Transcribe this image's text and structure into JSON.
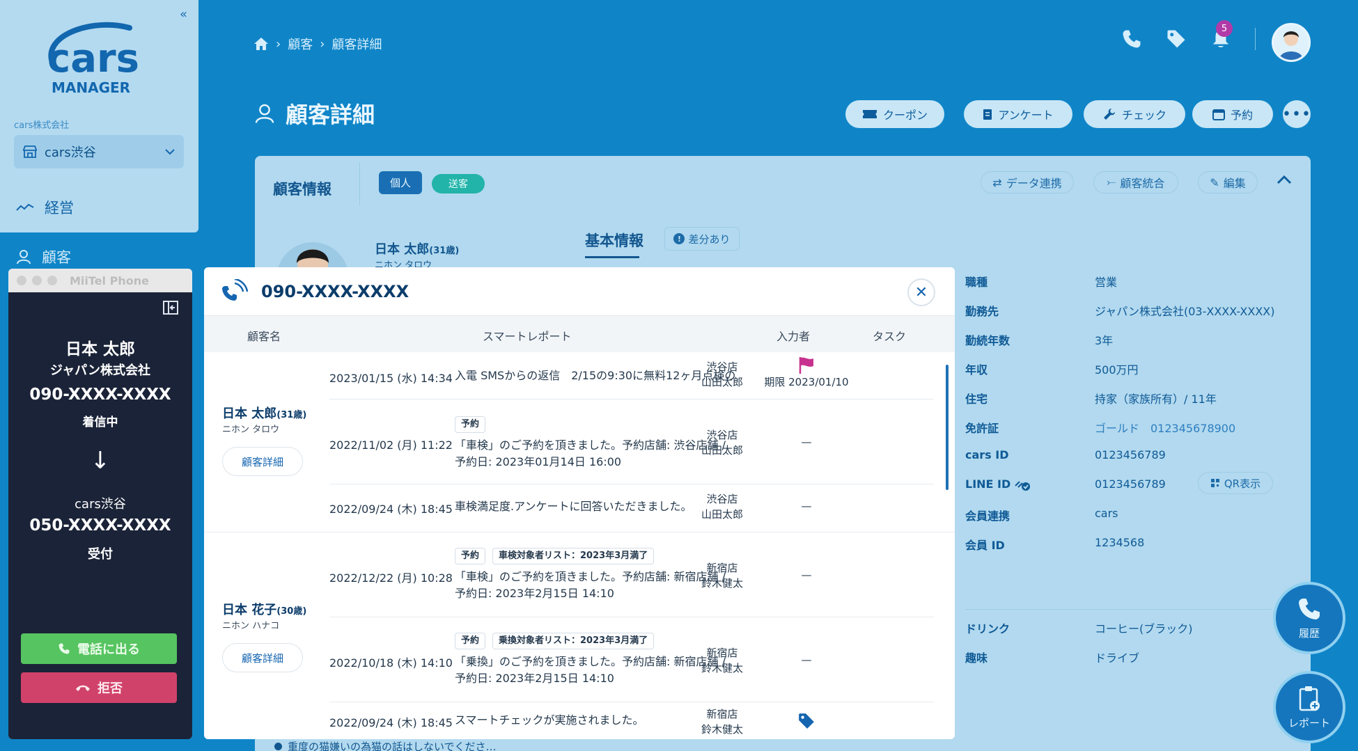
{
  "sidebar": {
    "logo_text": "cars",
    "logo_sub": "MANAGER",
    "company": "cars株式会社",
    "store": "cars渋谷",
    "nav": [
      {
        "label": "経営"
      },
      {
        "label": "顧客"
      }
    ]
  },
  "breadcrumb": {
    "items": [
      "顧客",
      "顧客詳細"
    ]
  },
  "header": {
    "notification_count": "5"
  },
  "page": {
    "title": "顧客詳細",
    "actions": [
      "クーポン",
      "アンケート",
      "チェック",
      "予約"
    ]
  },
  "card": {
    "title": "顧客情報",
    "tags": [
      "個人",
      "送客"
    ],
    "buttons": [
      "データ連携",
      "顧客統合",
      "編集"
    ],
    "customer_name": "日本 太郎",
    "customer_age": "(31歳)",
    "customer_kana": "ニホン タロウ",
    "tab": "基本情報",
    "diff_label": "差分あり",
    "info": [
      {
        "k": "職種",
        "v": "営業"
      },
      {
        "k": "勤務先",
        "v": "ジャパン株式会社(03-XXXX-XXXX)"
      },
      {
        "k": "勤続年数",
        "v": "3年"
      },
      {
        "k": "年収",
        "v": "500万円"
      },
      {
        "k": "住宅",
        "v": "持家（家族所有）/ 11年"
      },
      {
        "k": "免許証",
        "v": "ゴールド　012345678900"
      },
      {
        "k": "cars ID",
        "v": "0123456789"
      },
      {
        "k": "LINE ID",
        "v": "0123456789"
      },
      {
        "k": "会員連携",
        "v": "cars"
      },
      {
        "k": "会員 ID",
        "v": "1234568"
      }
    ],
    "qr_label": "QR表示",
    "info2": [
      {
        "k": "ドリンク",
        "v": "コーヒー(ブラック)"
      },
      {
        "k": "趣味",
        "v": "ドライブ"
      }
    ],
    "bottom_note": "重度の猫嫌いの為猫の話はしないでくださ…"
  },
  "fabs": {
    "history": "履歴",
    "report": "レポート"
  },
  "miitel": {
    "title": "MiiTel Phone",
    "caller_name": "日本 太郎",
    "caller_company": "ジャパン株式会社",
    "caller_number": "090-XXXX-XXXX",
    "status": "着信中",
    "arrow": "↓",
    "store": "cars渋谷",
    "store_number": "050-XXXX-XXXX",
    "store_status": "受付",
    "answer": "電話に出る",
    "reject": "拒否"
  },
  "modal": {
    "phone": "090-XXXX-XXXX",
    "headers": {
      "name": "顧客名",
      "report": "スマートレポート",
      "user": "入力者",
      "task": "タスク"
    },
    "groups": [
      {
        "name": "日本 太郎",
        "age": "(31歳)",
        "kana": "ニホン タロウ",
        "button": "顧客詳細",
        "rows": [
          {
            "date": "2023/01/15 (水) 14:34",
            "chips": [],
            "text": [
              "入電 SMSからの返信　2/15の9:30に無料12ヶ月点検の"
            ],
            "store": "渋谷店",
            "user": "山田太郎",
            "task": "期限 2023/01/10"
          },
          {
            "date": "2022/11/02 (月) 11:22",
            "chips": [
              "予約"
            ],
            "text": [
              "「車検」のご予約を頂きました。予約店舗: 渋谷店舗 /",
              "予約日: 2023年01月14日 16:00"
            ],
            "store": "渋谷店",
            "user": "山田太郎",
            "task": "—"
          },
          {
            "date": "2022/09/24 (木) 18:45",
            "chips": [],
            "text": [
              "車検満足度.アンケートに回答いただきました。"
            ],
            "store": "渋谷店",
            "user": "山田太郎",
            "task": "—"
          }
        ]
      },
      {
        "name": "日本 花子",
        "age": "(30歳)",
        "kana": "ニホン ハナコ",
        "button": "顧客詳細",
        "rows": [
          {
            "date": "2022/12/22 (月) 10:28",
            "chips": [
              "予約",
              "車検対象者リスト：2023年3月満了"
            ],
            "text": [
              "「車検」のご予約を頂きました。予約店舗: 新宿店舗 /",
              "予約日: 2023年2月15日 14:10"
            ],
            "store": "新宿店",
            "user": "鈴木健太",
            "task": "—"
          },
          {
            "date": "2022/10/18 (木) 14:10",
            "chips": [
              "予約",
              "乗換対象者リスト：2023年3月満了"
            ],
            "text": [
              "「乗換」のご予約を頂きました。予約店舗: 新宿店舗 /",
              "予約日: 2023年2月15日 14:10"
            ],
            "store": "新宿店",
            "user": "鈴木健太",
            "task": "—"
          },
          {
            "date": "2022/09/24 (木) 18:45",
            "chips": [],
            "text": [
              "スマートチェックが実施されました。"
            ],
            "store": "新宿店",
            "user": "鈴木健太",
            "task": ""
          }
        ]
      }
    ]
  }
}
